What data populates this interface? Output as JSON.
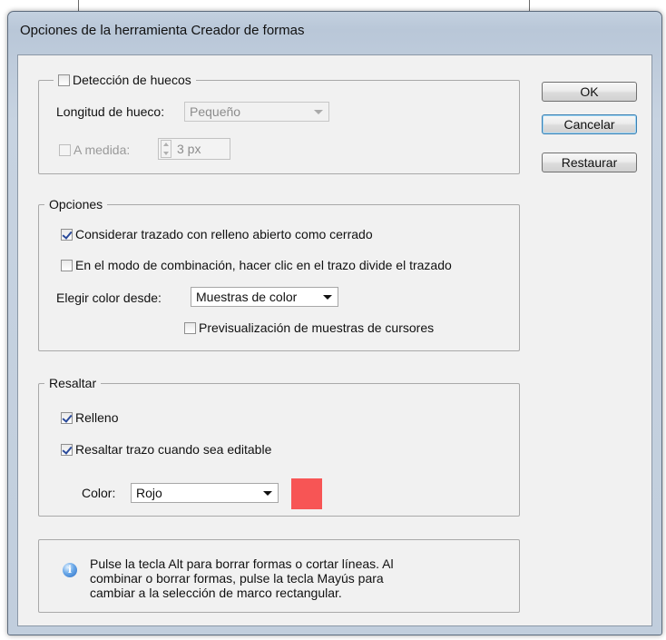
{
  "dialog": {
    "title": "Opciones de la herramienta Creador de formas"
  },
  "buttons": {
    "ok": "OK",
    "cancel": "Cancelar",
    "reset": "Restaurar"
  },
  "gap_detection": {
    "checkbox_label": "Detección de huecos",
    "checked": false,
    "length_label": "Longitud de hueco:",
    "length_value": "Pequeño",
    "custom_label": "A medida:",
    "custom_checked": false,
    "custom_value": "3 px"
  },
  "options": {
    "legend": "Opciones",
    "open_fill_label": "Considerar trazado con relleno abierto como cerrado",
    "open_fill_checked": true,
    "merge_split_label": "En el modo de combinación, hacer clic en el trazo divide el trazado",
    "merge_split_checked": false,
    "pick_color_label": "Elegir color desde:",
    "pick_color_value": "Muestras de color",
    "cursor_preview_label": "Previsualización de muestras de cursores",
    "cursor_preview_checked": false
  },
  "highlight": {
    "legend": "Resaltar",
    "fill_label": "Relleno",
    "fill_checked": true,
    "stroke_label": "Resaltar trazo cuando sea editable",
    "stroke_checked": true,
    "color_label": "Color:",
    "color_value": "Rojo",
    "swatch_color": "#f75555"
  },
  "info": {
    "icon": "info-icon",
    "line1": "Pulse la tecla Alt para borrar formas o cortar líneas. Al",
    "line2": "combinar o borrar formas, pulse la tecla Mayús para",
    "line3": "cambiar a la selección de marco rectangular."
  },
  "colors": {
    "dialog_background": "#f1f1f1",
    "window_frame": "#c3d0df",
    "default_button_border": "#3c7fb1"
  }
}
